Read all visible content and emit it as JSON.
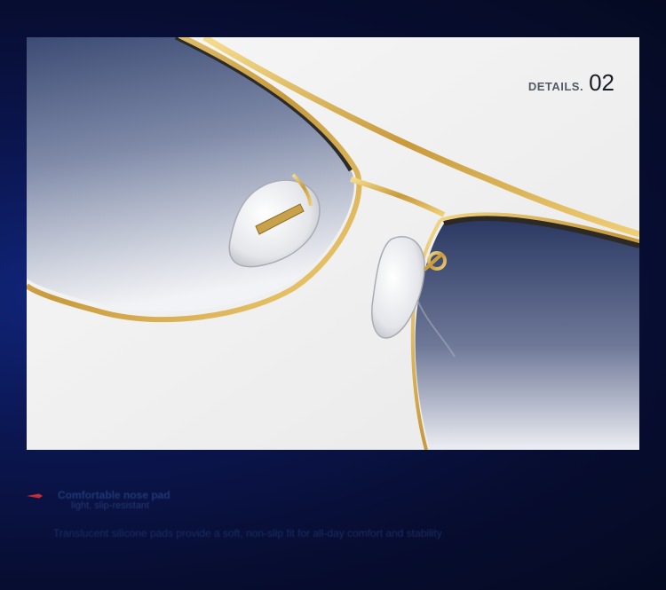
{
  "image": {
    "subject": "sunglasses-closeup",
    "colors": {
      "background_accent": "#10257a",
      "frame_gold": "#d9b35a",
      "lens_tint": "#2a3c68",
      "highlight": "#f3f3f3",
      "accent_red": "#c62a32"
    }
  },
  "details": {
    "label": "DETAILS.",
    "number": "02"
  },
  "caption": {
    "line1": "Comfortable nose pad",
    "line2": "light, slip-resistant",
    "line3": "Translucent silicone pads provide a soft, non-slip fit for all-day comfort and stability"
  }
}
